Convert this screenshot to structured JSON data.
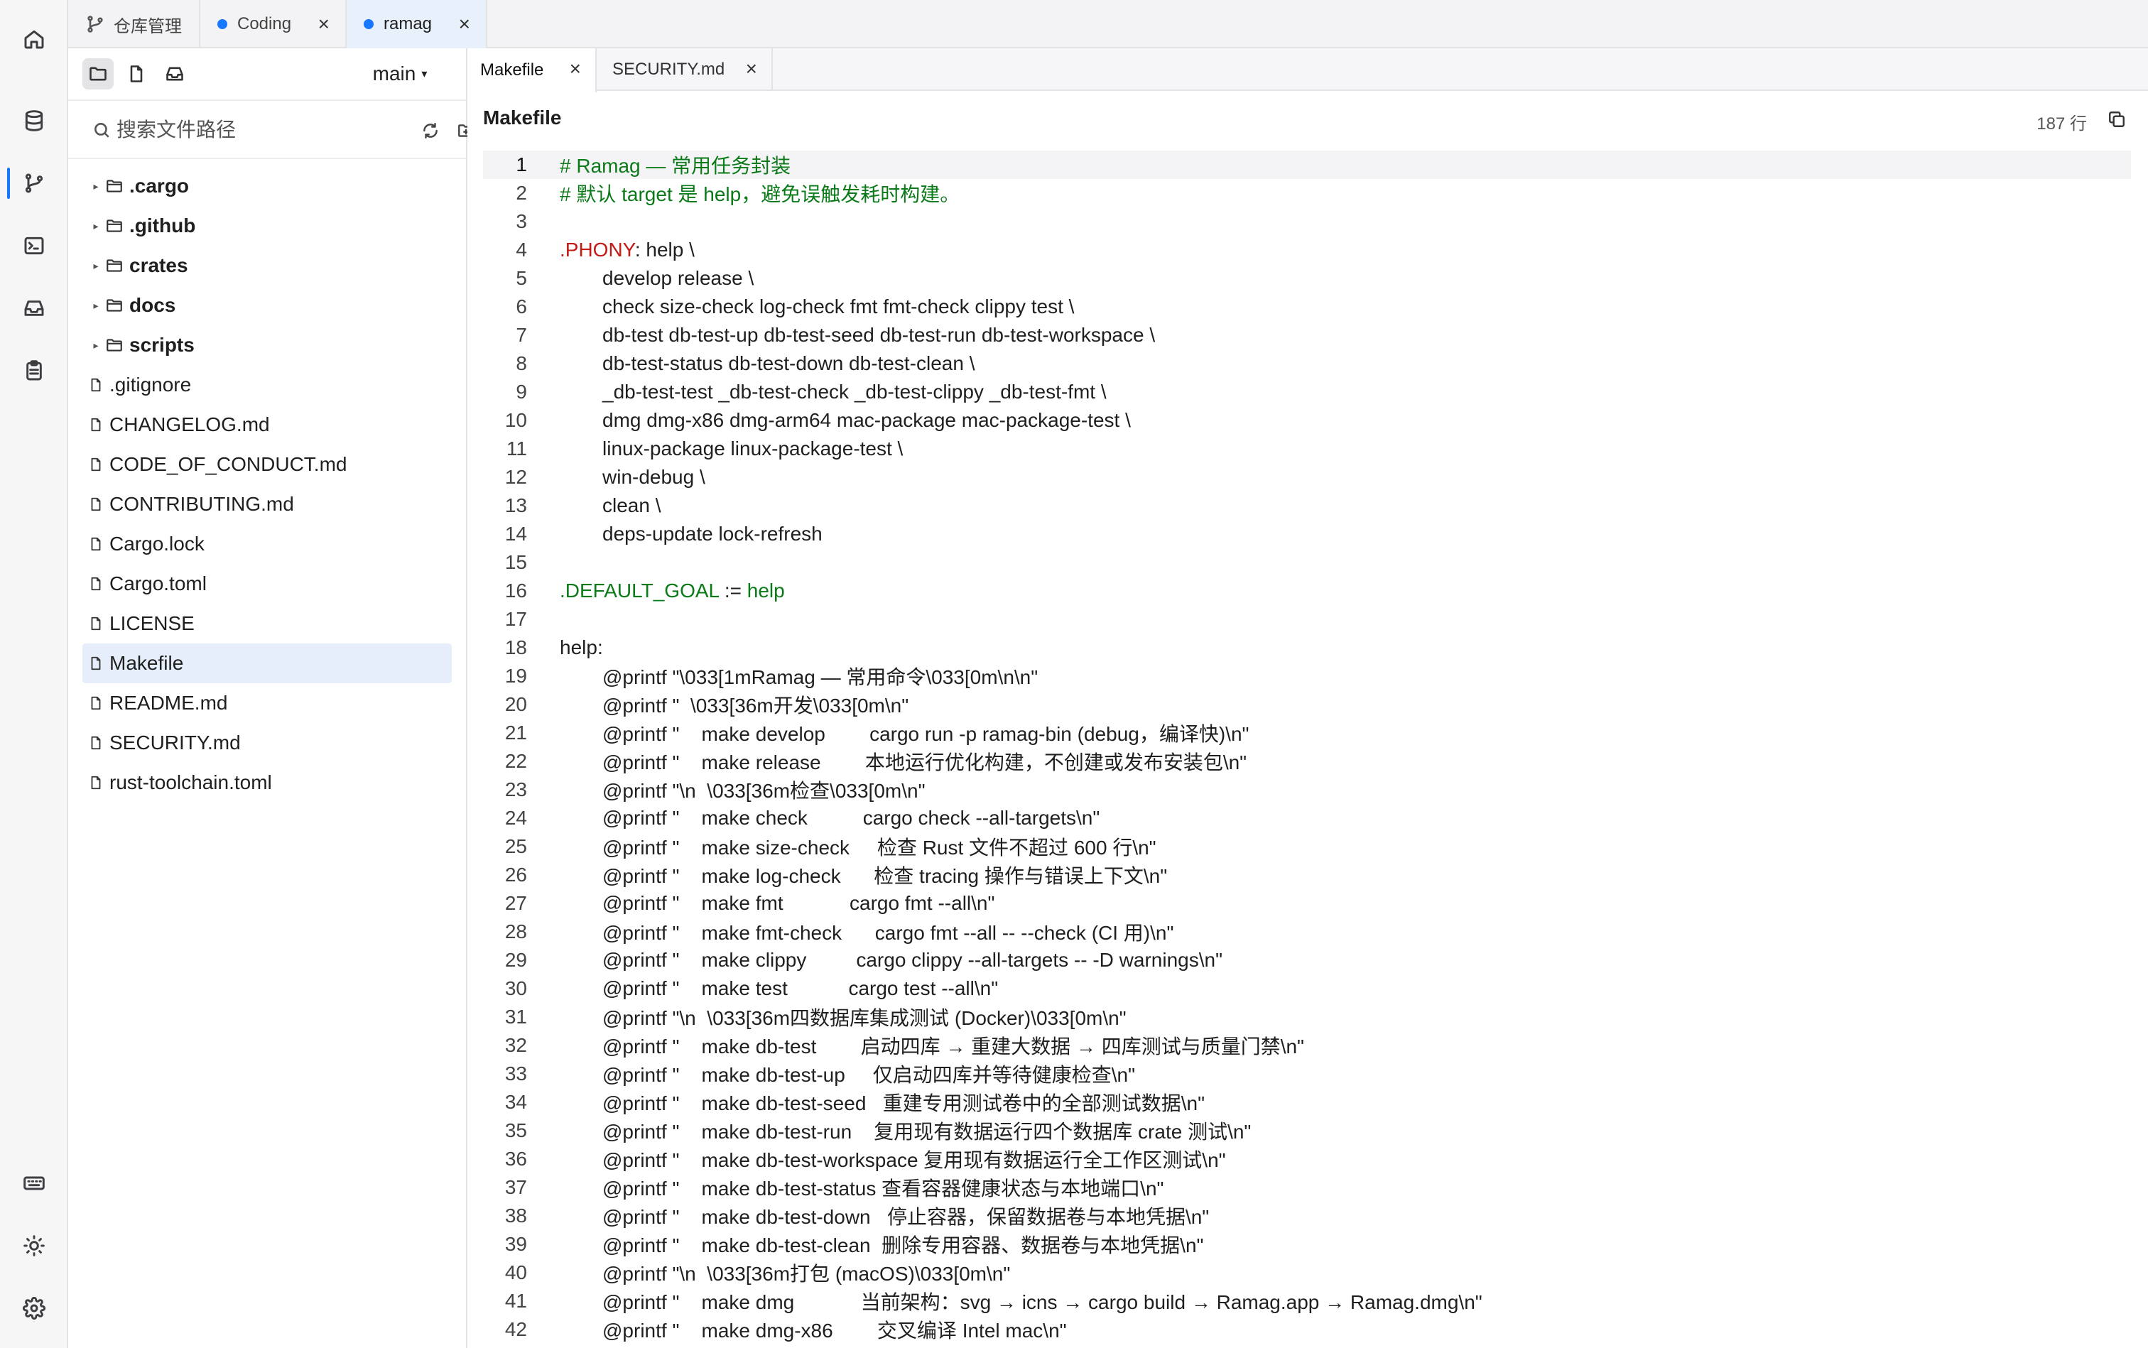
{
  "window_tabs": [
    {
      "label": "仓库管理",
      "icon": "git-branch-icon"
    },
    {
      "label": "Coding",
      "dot_color": "#1677ff",
      "close": "×"
    },
    {
      "label": "ramag",
      "dot_color": "#1677ff",
      "close": "×",
      "active": true
    }
  ],
  "rail": {
    "icons": [
      "home-icon",
      "database-icon",
      "git-branch-icon",
      "terminal-icon",
      "inbox-icon",
      "clipboard-icon",
      "keyboard-icon",
      "sun-icon",
      "gear-icon"
    ],
    "active_index": 2,
    "accent": "#1677ff"
  },
  "sidebar": {
    "view_icons": [
      "folder-icon",
      "file-icon",
      "inbox-icon"
    ],
    "branch": "main",
    "search_placeholder": "搜索文件路径",
    "tree": [
      {
        "name": ".cargo",
        "type": "folder"
      },
      {
        "name": ".github",
        "type": "folder"
      },
      {
        "name": "crates",
        "type": "folder"
      },
      {
        "name": "docs",
        "type": "folder"
      },
      {
        "name": "scripts",
        "type": "folder"
      },
      {
        "name": ".gitignore",
        "type": "file"
      },
      {
        "name": "CHANGELOG.md",
        "type": "file"
      },
      {
        "name": "CODE_OF_CONDUCT.md",
        "type": "file"
      },
      {
        "name": "CONTRIBUTING.md",
        "type": "file"
      },
      {
        "name": "Cargo.lock",
        "type": "file"
      },
      {
        "name": "Cargo.toml",
        "type": "file"
      },
      {
        "name": "LICENSE",
        "type": "file"
      },
      {
        "name": "Makefile",
        "type": "file",
        "selected": true
      },
      {
        "name": "README.md",
        "type": "file"
      },
      {
        "name": "SECURITY.md",
        "type": "file"
      },
      {
        "name": "rust-toolchain.toml",
        "type": "file"
      }
    ]
  },
  "editor": {
    "tabs": [
      {
        "label": "Makefile",
        "close": "×",
        "active": true
      },
      {
        "label": "SECURITY.md",
        "close": "×"
      }
    ],
    "file_name": "Makefile",
    "line_count": "187 行",
    "current_line": 1,
    "lines": [
      "# Ramag — 常用任务封装",
      "# 默认 target 是 help，避免误触发耗时构建。",
      "",
      ".PHONY: help \\",
      "\tdevelop release \\",
      "\tcheck size-check log-check fmt fmt-check clippy test \\",
      "\tdb-test db-test-up db-test-seed db-test-run db-test-workspace \\",
      "\tdb-test-status db-test-down db-test-clean \\",
      "\t_db-test-test _db-test-check _db-test-clippy _db-test-fmt \\",
      "\tdmg dmg-x86 dmg-arm64 mac-package mac-package-test \\",
      "\tlinux-package linux-package-test \\",
      "\twin-debug \\",
      "\tclean \\",
      "\tdeps-update lock-refresh",
      "",
      ".DEFAULT_GOAL := help",
      "",
      "help:",
      "\t@printf \"\\033[1mRamag — 常用命令\\033[0m\\n\\n\"",
      "\t@printf \"  \\033[36m开发\\033[0m\\n\"",
      "\t@printf \"    make develop        cargo run -p ramag-bin (debug，编译快)\\n\"",
      "\t@printf \"    make release        本地运行优化构建，不创建或发布安装包\\n\"",
      "\t@printf \"\\n  \\033[36m检查\\033[0m\\n\"",
      "\t@printf \"    make check          cargo check --all-targets\\n\"",
      "\t@printf \"    make size-check     检查 Rust 文件不超过 600 行\\n\"",
      "\t@printf \"    make log-check      检查 tracing 操作与错误上下文\\n\"",
      "\t@printf \"    make fmt            cargo fmt --all\\n\"",
      "\t@printf \"    make fmt-check      cargo fmt --all -- --check (CI 用)\\n\"",
      "\t@printf \"    make clippy         cargo clippy --all-targets -- -D warnings\\n\"",
      "\t@printf \"    make test           cargo test --all\\n\"",
      "\t@printf \"\\n  \\033[36m四数据库集成测试 (Docker)\\033[0m\\n\"",
      "\t@printf \"    make db-test        启动四库 → 重建大数据 → 四库测试与质量门禁\\n\"",
      "\t@printf \"    make db-test-up     仅启动四库并等待健康检查\\n\"",
      "\t@printf \"    make db-test-seed   重建专用测试卷中的全部测试数据\\n\"",
      "\t@printf \"    make db-test-run    复用现有数据运行四个数据库 crate 测试\\n\"",
      "\t@printf \"    make db-test-workspace 复用现有数据运行全工作区测试\\n\"",
      "\t@printf \"    make db-test-status 查看容器健康状态与本地端口\\n\"",
      "\t@printf \"    make db-test-down   停止容器，保留数据卷与本地凭据\\n\"",
      "\t@printf \"    make db-test-clean  删除专用容器、数据卷与本地凭据\\n\"",
      "\t@printf \"\\n  \\033[36m打包 (macOS)\\033[0m\\n\"",
      "\t@printf \"    make dmg            当前架构：svg → icns → cargo build → Ramag.app → Ramag.dmg\\n\"",
      "\t@printf \"    make dmg-x86        交叉编译 Intel mac\\n\""
    ],
    "colors": {
      "comment": "#0b7a18",
      "keyword": "#c41a16",
      "value": "#0b7a18"
    }
  }
}
